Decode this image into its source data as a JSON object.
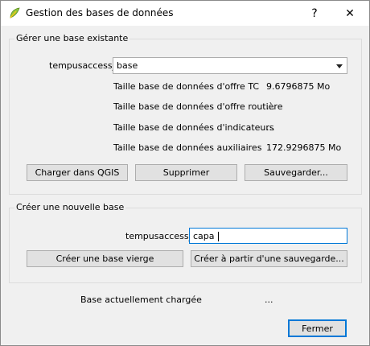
{
  "window": {
    "title": "Gestion des bases de données",
    "controls": {
      "help": "?",
      "close": "✕"
    }
  },
  "manage": {
    "group_title": "Gérer une base existante",
    "db_label": "tempusaccess_",
    "db_selected": "base",
    "stats": [
      {
        "label": "Taille base de données d'offre TC",
        "value": "9.6796875 Mo"
      },
      {
        "label": "Taille base de données d'offre routière",
        "value": "..."
      },
      {
        "label": "Taille base de données d'indicateurs",
        "value": "..."
      },
      {
        "label": "Taille base de données auxiliaires",
        "value": "172.9296875 Mo"
      }
    ],
    "buttons": {
      "load": "Charger dans QGIS",
      "delete": "Supprimer",
      "save": "Sauvegarder..."
    }
  },
  "create": {
    "group_title": "Créer une nouvelle base",
    "db_label": "tempusaccess_",
    "db_name_value": "capa",
    "buttons": {
      "blank": "Créer une base vierge",
      "from_backup": "Créer à partir d'une sauvegarde..."
    }
  },
  "status": {
    "label": "Base actuellement chargée",
    "value": "..."
  },
  "footer": {
    "close_label": "Fermer"
  },
  "icons": {
    "app": "qgis-leaf-icon",
    "dropdown": "chevron-down-icon"
  },
  "colors": {
    "focus": "#0078d7",
    "button_bg": "#e1e1e1",
    "window_bg": "#f0f0f0"
  }
}
